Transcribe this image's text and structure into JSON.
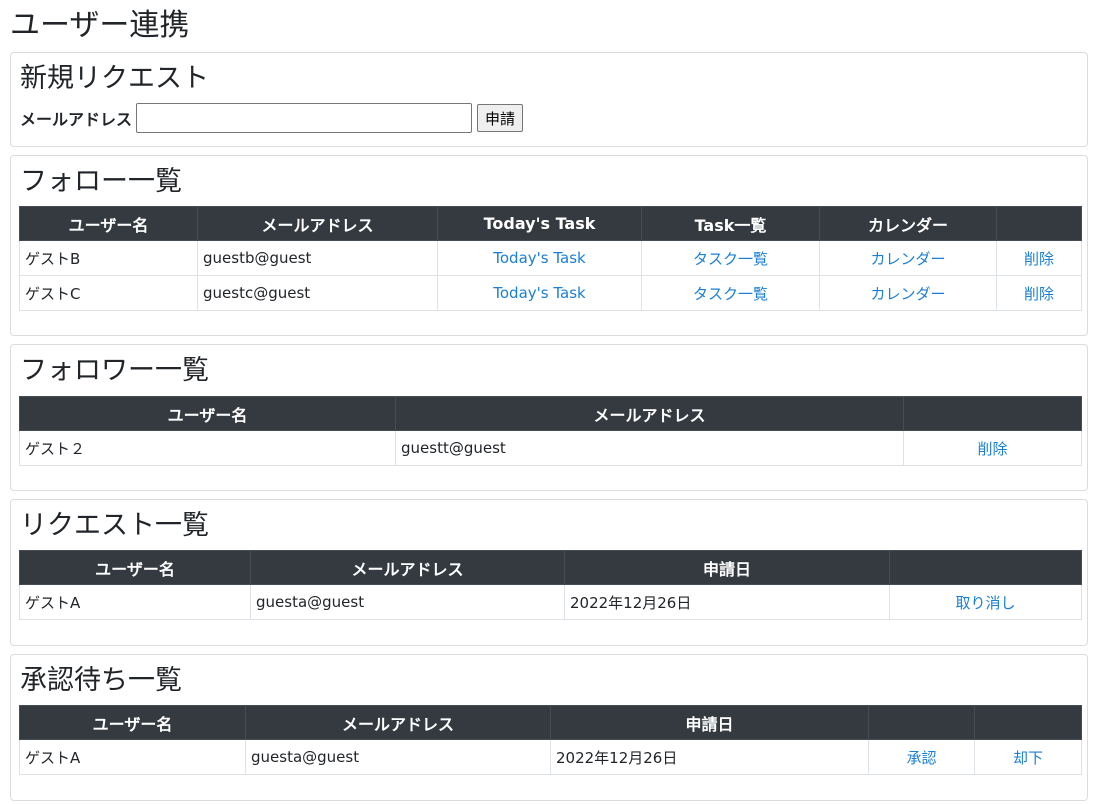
{
  "page": {
    "title": "ユーザー連携"
  },
  "new_request": {
    "title": "新規リクエスト",
    "email_label": "メールアドレス",
    "email_value": "",
    "submit_label": "申請"
  },
  "follow": {
    "title": "フォロー一覧",
    "headers": [
      "ユーザー名",
      "メールアドレス",
      "Today's Task",
      "Task一覧",
      "カレンダー",
      ""
    ],
    "rows": [
      {
        "name": "ゲストB",
        "email": "guestb@guest",
        "today": "Today's Task",
        "tasks": "タスク一覧",
        "calendar": "カレンダー",
        "delete": "削除"
      },
      {
        "name": "ゲストC",
        "email": "guestc@guest",
        "today": "Today's Task",
        "tasks": "タスク一覧",
        "calendar": "カレンダー",
        "delete": "削除"
      }
    ]
  },
  "follower": {
    "title": "フォロワー一覧",
    "headers": [
      "ユーザー名",
      "メールアドレス",
      ""
    ],
    "rows": [
      {
        "name": "ゲスト２",
        "email": "guestt@guest",
        "delete": "削除"
      }
    ]
  },
  "requests": {
    "title": "リクエスト一覧",
    "headers": [
      "ユーザー名",
      "メールアドレス",
      "申請日",
      ""
    ],
    "rows": [
      {
        "name": "ゲストA",
        "email": "guesta@guest",
        "date": "2022年12月26日",
        "cancel": "取り消し"
      }
    ]
  },
  "pending": {
    "title": "承認待ち一覧",
    "headers": [
      "ユーザー名",
      "メールアドレス",
      "申請日",
      "",
      ""
    ],
    "rows": [
      {
        "name": "ゲストA",
        "email": "guesta@guest",
        "date": "2022年12月26日",
        "approve": "承認",
        "reject": "却下"
      }
    ]
  },
  "colors": {
    "header_bg": "#343a40",
    "link": "#1a7fd6",
    "border": "#dee2e6"
  }
}
